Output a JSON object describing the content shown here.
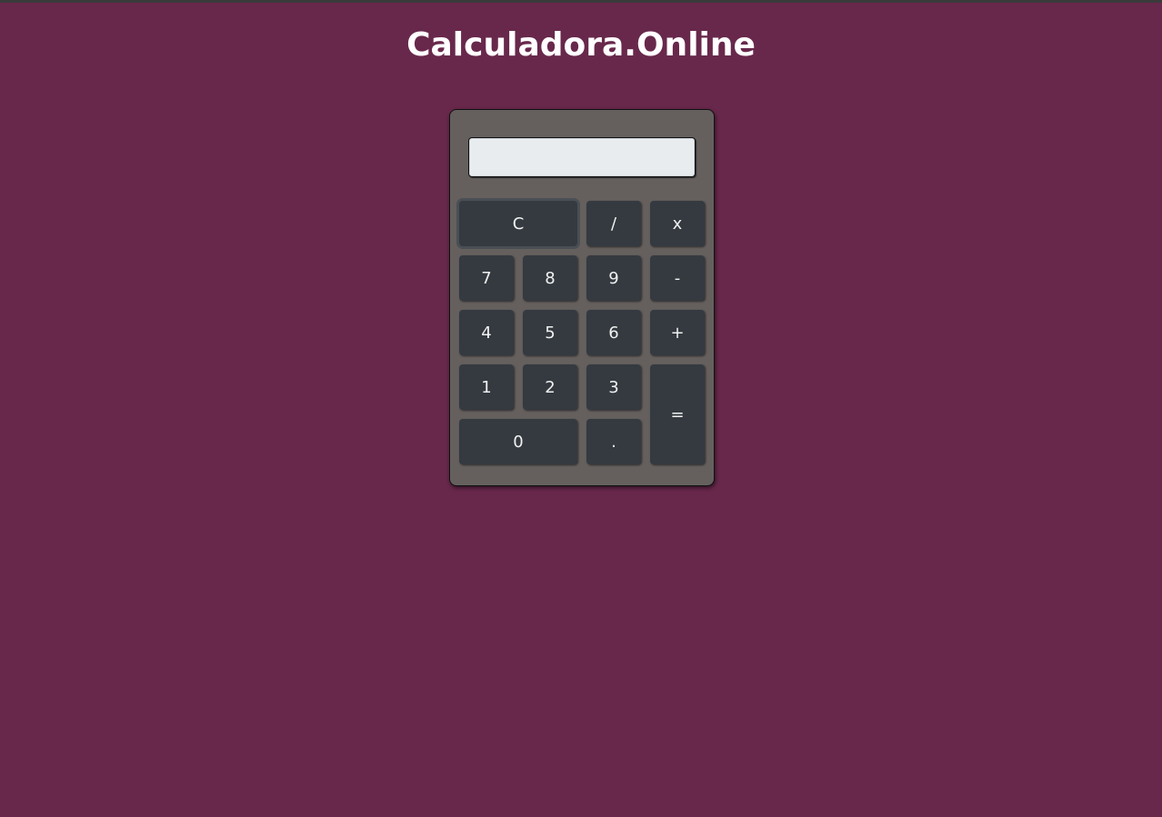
{
  "header": {
    "title": "Calculadora.Online"
  },
  "display": {
    "value": ""
  },
  "keys": {
    "clear": "C",
    "divide": "/",
    "multiply": "x",
    "seven": "7",
    "eight": "8",
    "nine": "9",
    "minus": "-",
    "four": "4",
    "five": "5",
    "six": "6",
    "plus": "+",
    "one": "1",
    "two": "2",
    "three": "3",
    "equals": "=",
    "zero": "0",
    "decimal": "."
  },
  "colors": {
    "background": "#68284b",
    "calculator_body": "#65605e",
    "key": "#343a40",
    "display": "#e8ecef",
    "title": "#ffffff"
  }
}
